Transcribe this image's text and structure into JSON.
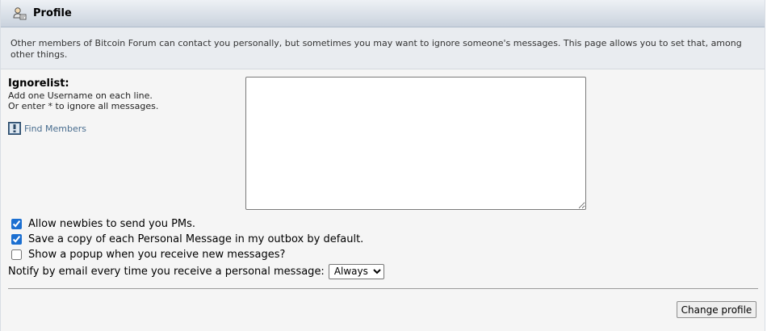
{
  "header": {
    "title": "Profile",
    "icon": "profile-user-icon"
  },
  "description": "Other members of Bitcoin Forum can contact you personally, but sometimes you may want to ignore someone's messages. This page allows you to set that, among other things.",
  "ignorelist": {
    "label": "Ignorelist:",
    "hint_line1": "Add one Username on each line.",
    "hint_line2": "Or enter * to ignore all messages.",
    "find_members_label": "Find Members",
    "find_members_icon": "search-members-icon",
    "value": ""
  },
  "options": {
    "allow_newbies": {
      "label": "Allow newbies to send you PMs.",
      "checked": true
    },
    "save_copy": {
      "label": "Save a copy of each Personal Message in my outbox by default.",
      "checked": true
    },
    "show_popup": {
      "label": "Show a popup when you receive new messages?",
      "checked": false
    }
  },
  "notify": {
    "label": "Notify by email every time you receive a personal message:",
    "selected": "Always"
  },
  "submit": {
    "label": "Change profile"
  },
  "colors": {
    "link": "#476c8e",
    "checkbox_accent": "#1b6fd1",
    "title_gradient_top": "#eef1f5",
    "title_gradient_bottom": "#c9d2dd"
  }
}
